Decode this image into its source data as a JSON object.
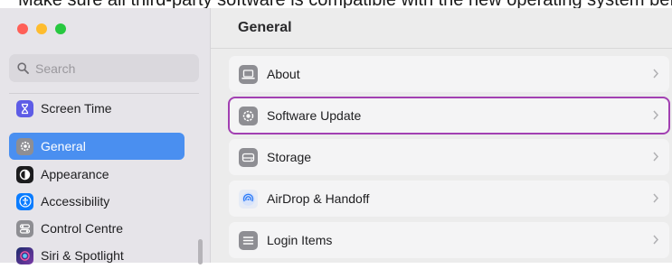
{
  "top_strip_text": "Make sure all third-party software is compatible with the new operating system before proceeding with macOS upgrade.",
  "colors": {
    "close": "#ff5f57",
    "minimize": "#febc2e",
    "zoom": "#28c840",
    "accent": "#4a8ff0",
    "highlight_outline": "#a240b2"
  },
  "search": {
    "placeholder": "Search",
    "icon": "search-icon"
  },
  "sidebar": {
    "items": [
      {
        "label": "Screen Time",
        "icon": "hourglass-icon",
        "active": false
      },
      {
        "label": "General",
        "icon": "gear-icon",
        "active": true
      },
      {
        "label": "Appearance",
        "icon": "appearance-icon",
        "active": false
      },
      {
        "label": "Accessibility",
        "icon": "accessibility-icon",
        "active": false
      },
      {
        "label": "Control Centre",
        "icon": "control-centre-icon",
        "active": false
      },
      {
        "label": "Siri & Spotlight",
        "icon": "siri-icon",
        "active": false
      }
    ]
  },
  "main": {
    "title": "General",
    "rows": [
      {
        "label": "About",
        "icon": "laptop-icon"
      },
      {
        "label": "Software Update",
        "icon": "software-update-icon",
        "highlighted": true
      },
      {
        "label": "Storage",
        "icon": "storage-icon"
      },
      {
        "label": "AirDrop & Handoff",
        "icon": "airdrop-icon"
      },
      {
        "label": "Login Items",
        "icon": "list-icon"
      }
    ]
  }
}
